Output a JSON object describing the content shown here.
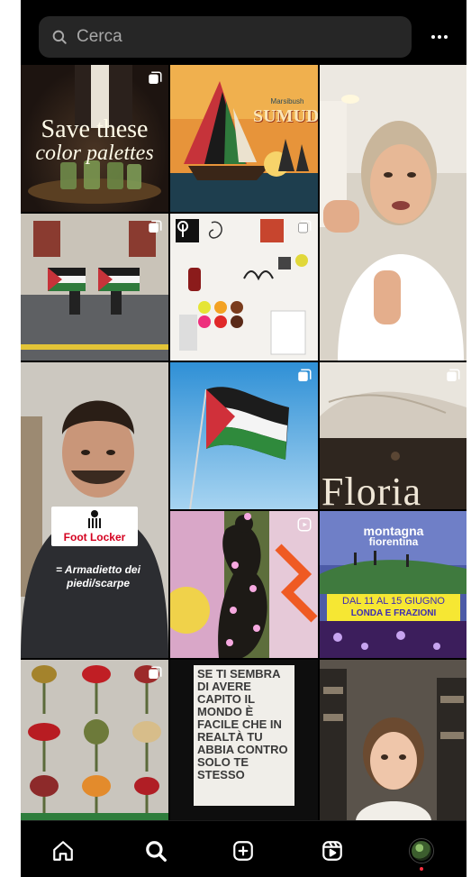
{
  "search": {
    "placeholder": "Cerca"
  },
  "tiles": {
    "palette_title_line1": "Save these",
    "palette_title_line2": "color palettes",
    "sumud_title": "SUMUD",
    "sumud_sub": "Marsibush",
    "floria_title": "Floria",
    "footlocker_logo": "Foot Locker",
    "footlocker_caption": "= Armadietto dei piedi/scarpe",
    "poem_text": "SE TI SEMBRA DI AVERE CAPITO IL MONDO È FACILE CHE IN REALTÀ TU ABBIA CONTRO SOLO TE STESSO",
    "montagna_line1": "montagna",
    "montagna_line2": "fiorentina",
    "dates_line1": "DAL 11 AL 15 GIUGNO",
    "dates_line2": "LONDA E FRAZIONI"
  },
  "bottom_nav": {
    "items": [
      "home-icon",
      "search-icon",
      "create-icon",
      "reels-icon",
      "profile-avatar"
    ],
    "active": "search-icon",
    "notification_color": "#ff3040"
  },
  "colors": {
    "background": "#000000",
    "search_bg": "#262626",
    "search_text": "#a8a8a8"
  }
}
